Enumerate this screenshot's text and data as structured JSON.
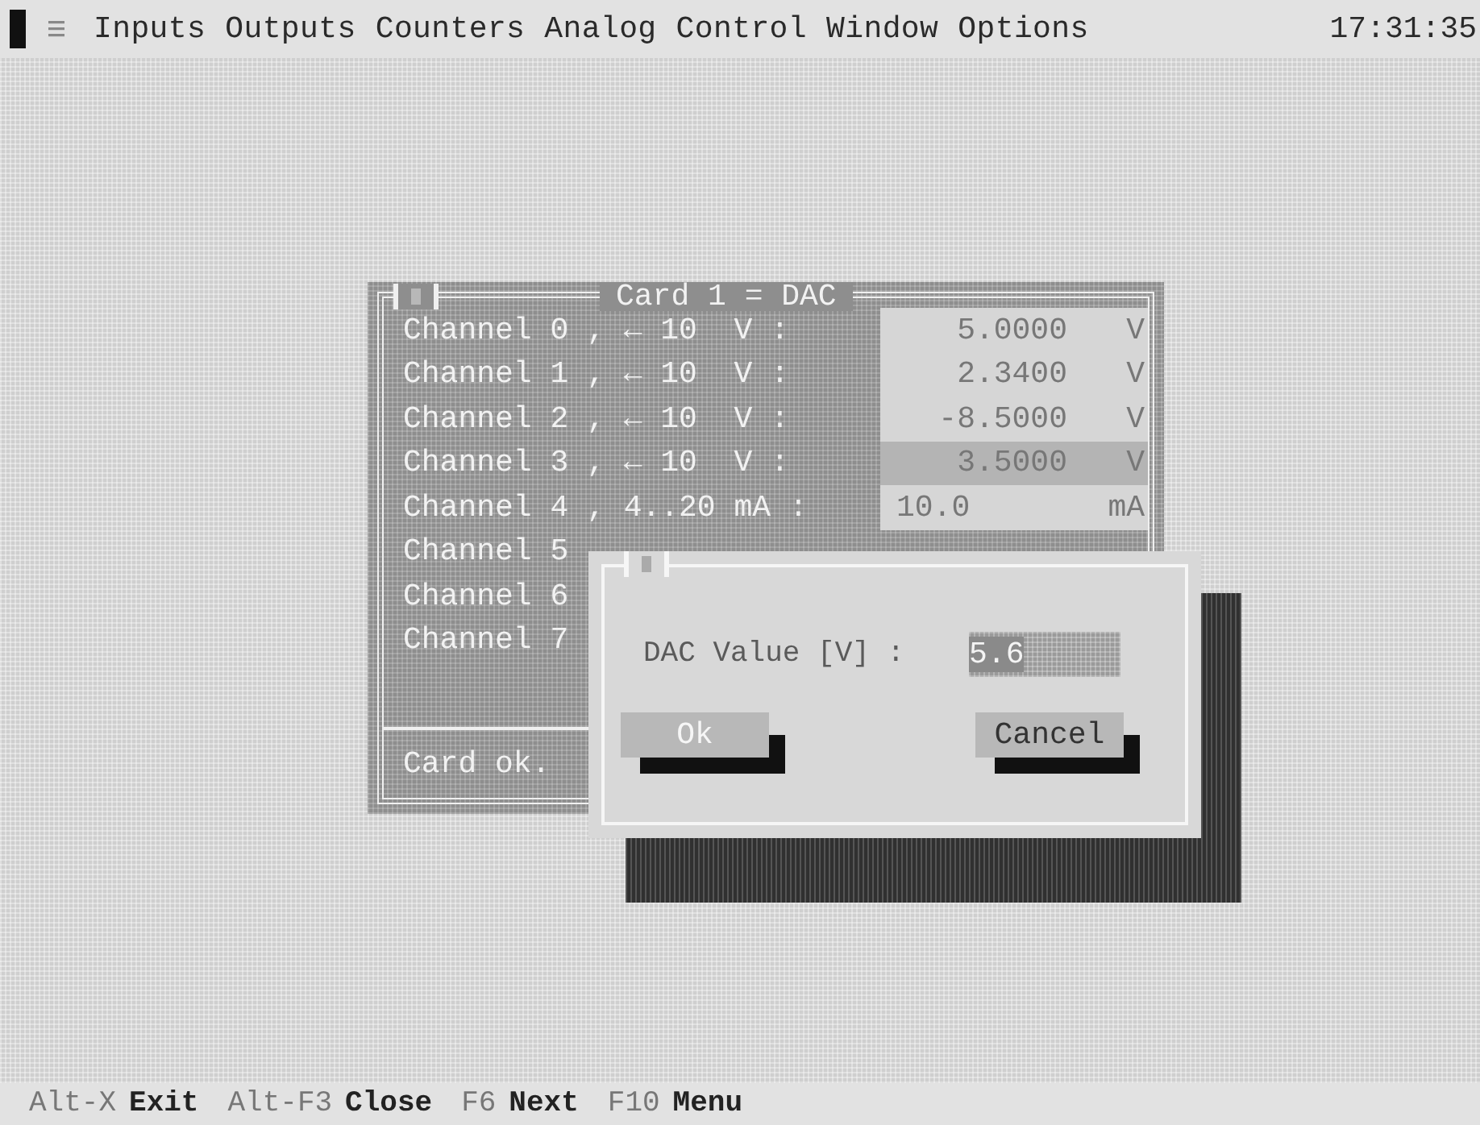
{
  "menu_bar": {
    "items": [
      {
        "label": "Inputs"
      },
      {
        "label": "Outputs"
      },
      {
        "label": "Counters"
      },
      {
        "label": "Analog"
      },
      {
        "label": "Control"
      },
      {
        "label": "Window"
      },
      {
        "label": "Options"
      }
    ],
    "clock": "17:31:35"
  },
  "card_window": {
    "title": "Card 1 = DAC",
    "channels": [
      {
        "label": "Channel 0 , ← 10  V :",
        "kind": "voltage",
        "value": "5.0000",
        "unit": "V",
        "selected": false
      },
      {
        "label": "Channel 1 , ← 10  V :",
        "kind": "voltage",
        "value": "2.3400",
        "unit": "V",
        "selected": false
      },
      {
        "label": "Channel 2 , ← 10  V :",
        "kind": "voltage",
        "value": "-8.5000",
        "unit": "V",
        "selected": false
      },
      {
        "label": "Channel 3 , ← 10  V :",
        "kind": "voltage",
        "value": "3.5000",
        "unit": "V",
        "selected": true
      },
      {
        "label": "Channel 4 , 4..20 mA :",
        "kind": "current",
        "value": "10.0",
        "unit": "mA",
        "selected": false
      },
      {
        "label": "Channel 5",
        "kind": "hidden"
      },
      {
        "label": "Channel 6",
        "kind": "hidden"
      },
      {
        "label": "Channel 7",
        "kind": "hidden"
      }
    ],
    "status": "Card ok."
  },
  "dialog": {
    "field_label": "DAC Value [V] :",
    "field_value": "5.6",
    "buttons": [
      {
        "label": "Ok",
        "default": true
      },
      {
        "label": "Cancel",
        "default": false
      }
    ]
  },
  "status_bar": [
    {
      "key": "Alt-X",
      "label": "Exit"
    },
    {
      "key": "Alt-F3",
      "label": "Close"
    },
    {
      "key": "F6",
      "label": "Next"
    },
    {
      "key": "F10",
      "label": "Menu"
    }
  ]
}
